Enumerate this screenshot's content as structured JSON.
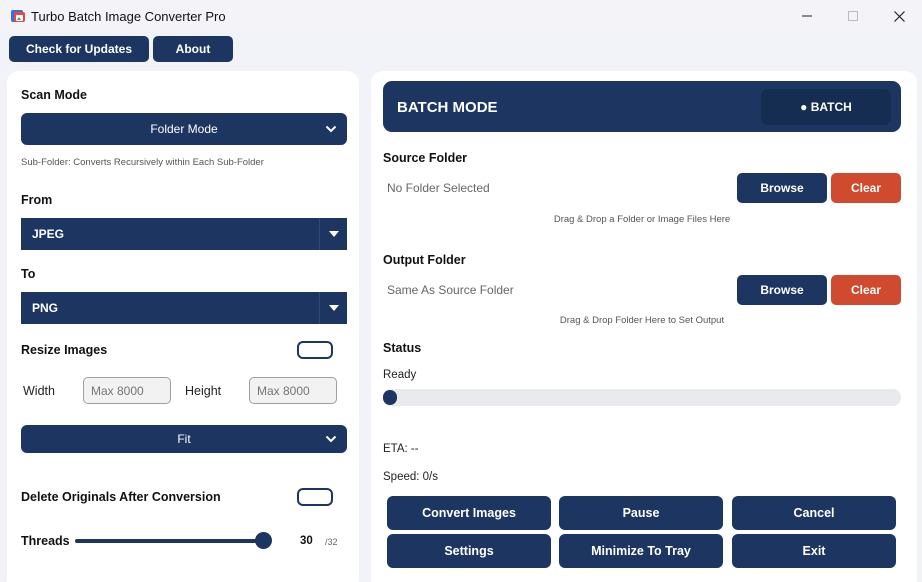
{
  "window": {
    "title": "Turbo Batch Image Converter Pro"
  },
  "toolbar": {
    "check_updates": "Check for Updates",
    "about": "About"
  },
  "left": {
    "scan_mode_label": "Scan Mode",
    "scan_mode_value": "Folder Mode",
    "scan_mode_hint": "Sub-Folder: Converts Recursively within Each Sub-Folder",
    "from_label": "From",
    "from_value": "JPEG",
    "to_label": "To",
    "to_value": "PNG",
    "resize_label": "Resize Images",
    "resize_enabled": false,
    "width_label": "Width",
    "width_placeholder": "Max 8000",
    "height_label": "Height",
    "height_placeholder": "Max 8000",
    "fit_value": "Fit",
    "delete_label": "Delete Originals After Conversion",
    "delete_enabled": false,
    "threads_label": "Threads",
    "threads_value": "30",
    "threads_max": "/32",
    "threads_fraction": 0.9375
  },
  "right": {
    "mode_title": "BATCH MODE",
    "mode_badge": "● BATCH",
    "source_label": "Source Folder",
    "source_value": "No Folder Selected",
    "source_hint": "Drag & Drop a Folder or Image Files Here",
    "output_label": "Output Folder",
    "output_value": "Same As Source Folder",
    "output_hint": "Drag & Drop Folder Here to Set Output",
    "browse": "Browse",
    "clear": "Clear",
    "status_label": "Status",
    "status_value": "Ready",
    "progress": 0,
    "eta": "ETA: --",
    "speed": "Speed: 0/s"
  },
  "actions": {
    "convert": "Convert Images",
    "pause": "Pause",
    "cancel": "Cancel",
    "settings": "Settings",
    "minimize_tray": "Minimize To Tray",
    "exit": "Exit"
  },
  "colors": {
    "navy": "#1c3661",
    "red": "#cf4a2e",
    "background": "#f2f2f9"
  }
}
